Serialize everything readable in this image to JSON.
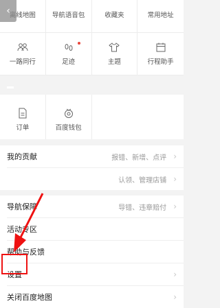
{
  "grid_row1": [
    {
      "label": "离线地图"
    },
    {
      "label": "导航语音包"
    },
    {
      "label": "收藏夹"
    },
    {
      "label": "常用地址"
    }
  ],
  "grid_row2": [
    {
      "label": "一路同行",
      "icon": "people-icon"
    },
    {
      "label": "足迹",
      "icon": "footprint-icon",
      "badge": true
    },
    {
      "label": "主题",
      "icon": "shirt-icon"
    },
    {
      "label": "行程助手",
      "icon": "calendar-icon"
    }
  ],
  "grid_row3": [
    {
      "label": "订单",
      "icon": "document-icon"
    },
    {
      "label": "百度钱包",
      "icon": "wallet-icon"
    }
  ],
  "menu": [
    {
      "label": "我的贡献",
      "sub": "报错、新增、点评"
    },
    {
      "label": "",
      "sub": "认领、管理店铺"
    },
    {
      "label": "导航保障",
      "sub": "导错、违章赔付"
    },
    {
      "label": "活动专区",
      "sub": ""
    },
    {
      "label": "帮助与反馈",
      "sub": ""
    },
    {
      "label": "设置",
      "sub": ""
    },
    {
      "label": "关闭百度地图",
      "sub": ""
    }
  ],
  "colors": {
    "annotation": "#e11111",
    "badge": "#e8463a"
  }
}
